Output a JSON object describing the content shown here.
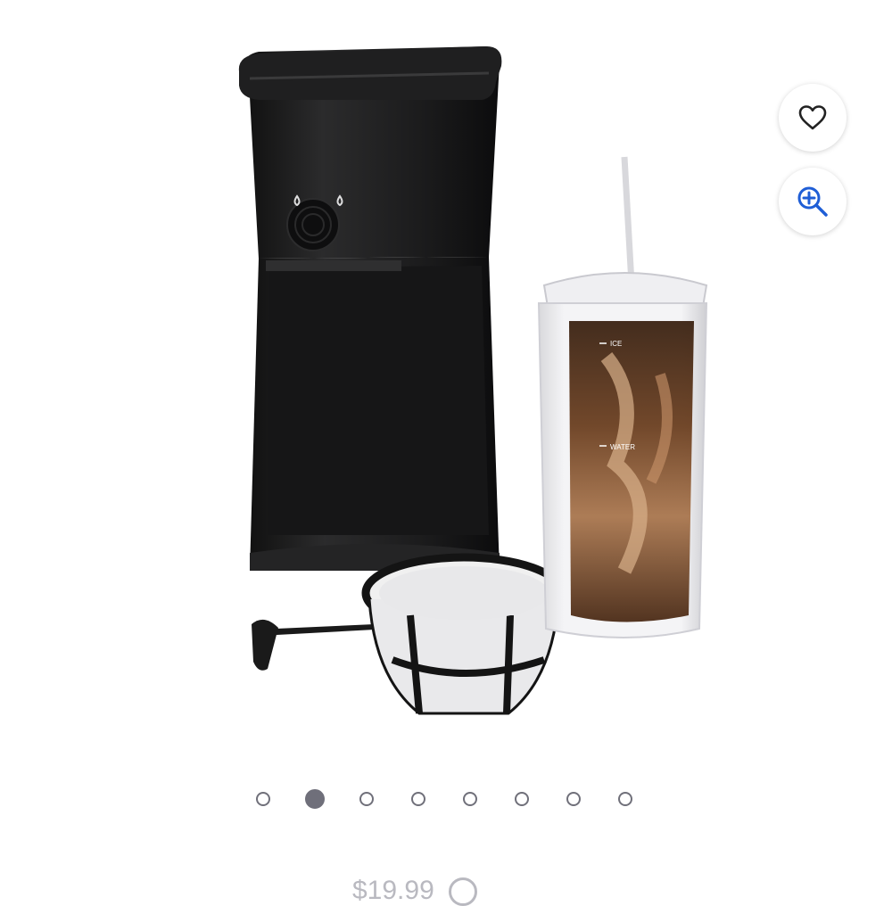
{
  "product": {
    "cup_marks": {
      "ice": "ICE",
      "water": "WATER"
    }
  },
  "actions": {
    "favorite_icon": "heart-icon",
    "zoom_icon": "zoom-in-icon"
  },
  "carousel": {
    "total": 8,
    "active_index": 1
  },
  "price": {
    "text": "$19.99"
  },
  "colors": {
    "dot": "#6f6f7a",
    "machine": "#1e1e1f",
    "coffee": "#6b3f20"
  }
}
